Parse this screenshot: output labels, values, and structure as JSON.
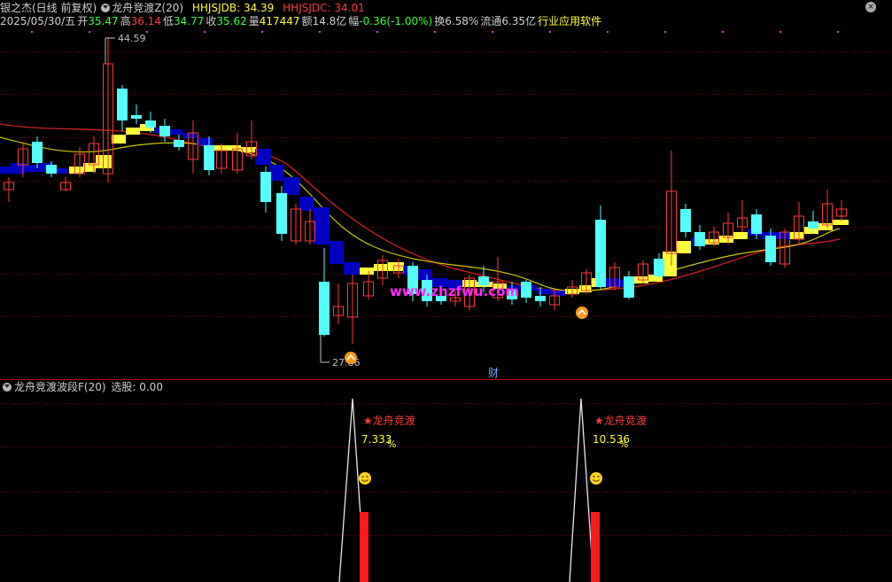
{
  "header": {
    "stock_name": "银之杰(日线 前复权)",
    "indicator_name": "龙舟竞渡Z(20)",
    "hhjsjdb": "HHJSJDB: 34.39",
    "hhjsjdc": "HHJSJDC: 34.01",
    "date": "2025/05/30/五",
    "open_label": "开",
    "open_value": "35.47",
    "high_label": "高",
    "high_value": "36.14",
    "low_label": "低",
    "low_value": "34.77",
    "close_label": "收",
    "close_value": "35.62",
    "volume_label": "量",
    "volume_value": "417447",
    "amount_label": "额",
    "amount_value": "14.8亿",
    "change_label": "幅",
    "change_value": "-0.36(-1.00%)",
    "turnover_label": "换",
    "turnover_value": "6.58%",
    "float_label": "流通",
    "float_value": "6.35亿",
    "industry": "行业应用软件",
    "close_button": "×"
  },
  "main_chart": {
    "high_marker": "44.59",
    "low_marker": "27.86",
    "watermark": "www.zhzfwu.com",
    "finance_marker": "财"
  },
  "sub_chart": {
    "title": "龙舟竞渡波段F(20)",
    "value_text": "选股: 0.00",
    "signals": [
      {
        "label": "★龙舟竞渡",
        "value": "7.333",
        "unit": "%"
      },
      {
        "label": "★龙舟竞渡",
        "value": "10.536",
        "unit": "%"
      }
    ]
  },
  "colors": {
    "up": "#ff3a3a",
    "down": "#54ffff",
    "yellow": "#ffff3a",
    "blue": "#0000c0",
    "ma_red": "#d42020",
    "ma_yellow": "#c8c800",
    "grid": "#8b0000"
  }
}
